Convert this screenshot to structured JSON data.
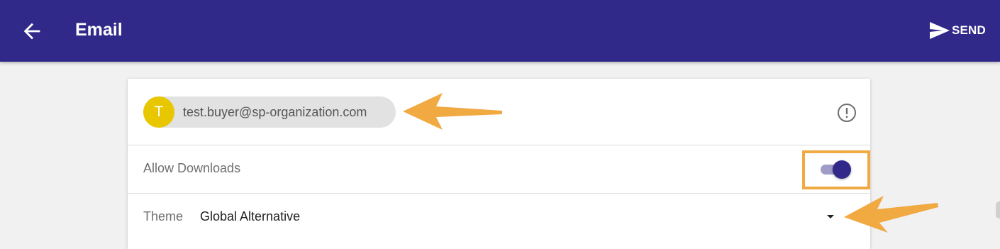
{
  "appbar": {
    "title": "Email",
    "send_label": "SEND",
    "color": "#30298a"
  },
  "recipient": {
    "avatar_letter": "T",
    "email": "test.buyer@sp-organization.com",
    "avatar_color": "#e8c700"
  },
  "allow_downloads": {
    "label": "Allow Downloads",
    "enabled": true
  },
  "theme": {
    "label": "Theme",
    "value": "Global Alternative"
  },
  "annotation_color": "#f1a942"
}
